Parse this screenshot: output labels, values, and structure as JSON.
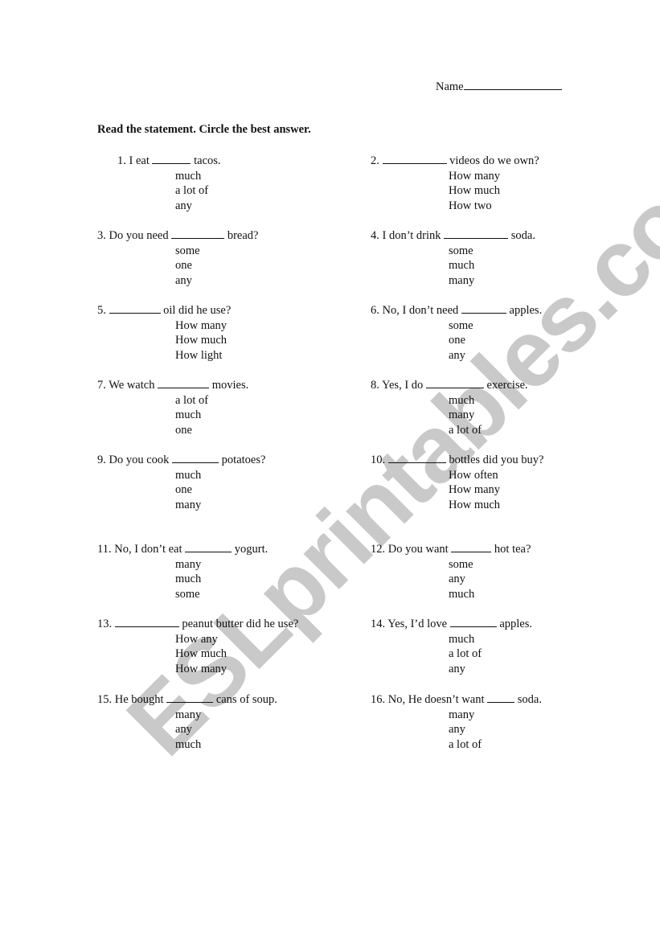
{
  "watermark": "ESLprintables.com",
  "header": {
    "name_label": "Name"
  },
  "instructions": "Read the statement. Circle the best answer.",
  "questions": [
    {
      "num": "1.",
      "before": "I eat",
      "after": "tacos.",
      "options": [
        "much",
        "a lot of",
        "any"
      ]
    },
    {
      "num": "2.",
      "before": "",
      "after": "videos do we own?",
      "options": [
        "How many",
        "How much",
        "How two"
      ]
    },
    {
      "num": "3.",
      "before": "Do you need",
      "after": "bread?",
      "options": [
        "some",
        "one",
        "any"
      ]
    },
    {
      "num": "4.",
      "before": "I don’t drink",
      "after": "soda.",
      "options": [
        "some",
        "much",
        "many"
      ]
    },
    {
      "num": "5.",
      "before": "",
      "after": "oil did he use?",
      "options": [
        "How many",
        "How much",
        "How light"
      ]
    },
    {
      "num": "6.",
      "before": "No, I don’t need",
      "after": "apples.",
      "options": [
        "some",
        "one",
        "any"
      ]
    },
    {
      "num": "7.",
      "before": "We watch",
      "after": "movies.",
      "options": [
        "a lot of",
        "much",
        "one"
      ]
    },
    {
      "num": "8.",
      "before": "Yes, I do",
      "after": "exercise.",
      "options": [
        "much",
        "many",
        "a lot of"
      ]
    },
    {
      "num": "9.",
      "before": "Do you cook",
      "after": "potatoes?",
      "options": [
        "much",
        "one",
        "many"
      ]
    },
    {
      "num": "10.",
      "before": "",
      "after": "bottles did you buy?",
      "options": [
        "How often",
        "How many",
        "How much"
      ]
    },
    {
      "num": "11.",
      "before": "No, I don’t eat",
      "after": "yogurt.",
      "options": [
        "many",
        "much",
        "some"
      ]
    },
    {
      "num": "12.",
      "before": "Do you want",
      "after": "hot tea?",
      "options": [
        "some",
        "any",
        "much"
      ]
    },
    {
      "num": "13.",
      "before": "",
      "after": "peanut butter did he use?",
      "options": [
        "How any",
        "How much",
        "How many"
      ]
    },
    {
      "num": "14.",
      "before": "Yes, I’d love",
      "after": "apples.",
      "options": [
        "much",
        "a lot of",
        "any"
      ]
    },
    {
      "num": "15.",
      "before": "He bought",
      "after": "cans of soup.",
      "options": [
        "many",
        "any",
        "much"
      ]
    },
    {
      "num": "16.",
      "before": "No, He doesn’t want",
      "after": "soda.",
      "options": [
        "many",
        "any",
        "a lot of"
      ]
    }
  ]
}
